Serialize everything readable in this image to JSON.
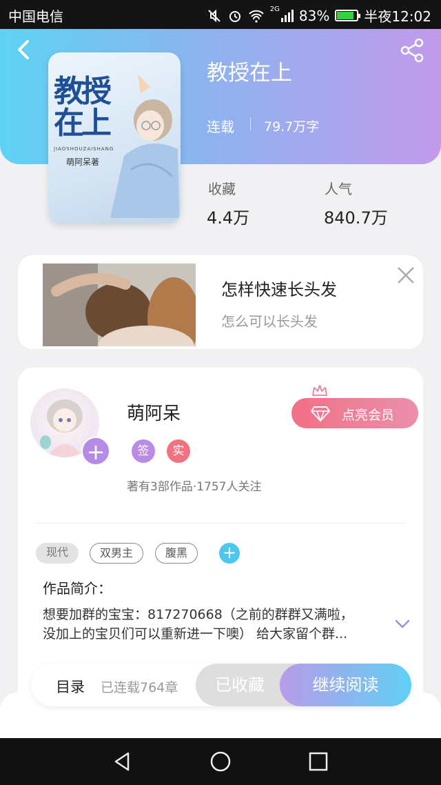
{
  "status_bar": {
    "carrier": "中国电信",
    "network": "2G",
    "battery": "83%",
    "battery_level": 0.83,
    "time": "半夜12:02"
  },
  "book": {
    "cover_title": "教授在上",
    "cover_pinyin": "JIAOSHOUZAISHANG",
    "cover_author": "萌阿呆著",
    "title": "教授在上",
    "status": "连载",
    "word_count": "79.7万字"
  },
  "stats": [
    {
      "label": "收藏",
      "value": "4.4万"
    },
    {
      "label": "人气",
      "value": "840.7万"
    }
  ],
  "ad": {
    "title": "怎样快速长头发",
    "subtitle": "怎么可以长头发"
  },
  "author": {
    "name": "萌阿呆",
    "badges": [
      {
        "text": "签",
        "color": "#b98be6"
      },
      {
        "text": "实",
        "color": "#f2727f"
      }
    ],
    "meta": "著有3部作品·1757人关注",
    "vip_button": "点亮会员"
  },
  "tags": [
    "现代",
    "双男主",
    "腹黑"
  ],
  "intro": {
    "label": "作品简介：",
    "line1": "想要加群的宝宝：817270668（之前的群群又满啦，",
    "line2": "没加上的宝贝们可以重新进一下噢） 给大家留个群..."
  },
  "bottom_bar": {
    "toc": "目录",
    "chapters": "已连载764章",
    "collected": "已收藏",
    "continue": "继续阅读"
  },
  "icons": {
    "back": "back-arrow-icon",
    "share": "share-icon",
    "close": "close-icon",
    "expand": "chevron-down-icon",
    "nav_back": "nav-back-icon",
    "nav_home": "nav-home-icon",
    "nav_recent": "nav-recent-icon"
  }
}
